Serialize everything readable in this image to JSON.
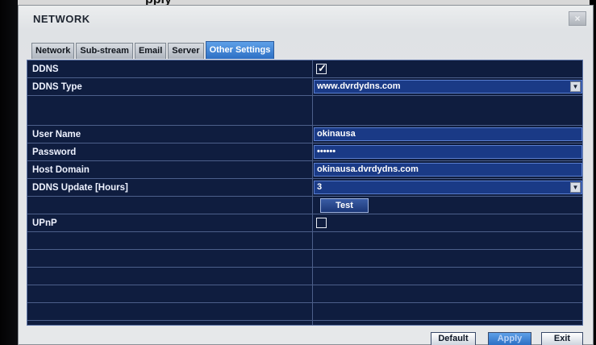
{
  "backdrop": {
    "partial_text": "pply"
  },
  "dialog": {
    "title": "NETWORK",
    "close_label": "×"
  },
  "tabs": [
    {
      "label": "Network",
      "active": false
    },
    {
      "label": "Sub-stream",
      "active": false
    },
    {
      "label": "Email",
      "active": false
    },
    {
      "label": "Server",
      "active": false
    },
    {
      "label": "Other Settings",
      "active": true
    }
  ],
  "settings": {
    "ddns": {
      "label": "DDNS",
      "checked": true,
      "mark": "✓"
    },
    "ddns_type": {
      "label": "DDNS Type",
      "value": "www.dvrdydns.com"
    },
    "user_name": {
      "label": "User Name",
      "value": "okinausa"
    },
    "password": {
      "label": "Password",
      "value": "••••••"
    },
    "host_domain": {
      "label": "Host Domain",
      "value": "okinausa.dvrdydns.com"
    },
    "ddns_update": {
      "label": "DDNS Update [Hours]",
      "value": "3"
    },
    "test_button": "Test",
    "upnp": {
      "label": "UPnP",
      "checked": false
    }
  },
  "footer": {
    "default_label": "Default",
    "apply_label": "Apply",
    "exit_label": "Exit"
  },
  "colors": {
    "panel_bg": "#0f1d3f",
    "field_bg": "#1a3a86",
    "active_tab": "#2c6fc4"
  },
  "icons": {
    "close": "close-icon",
    "dropdown": "chevron-down-icon",
    "check": "checkmark-icon"
  }
}
